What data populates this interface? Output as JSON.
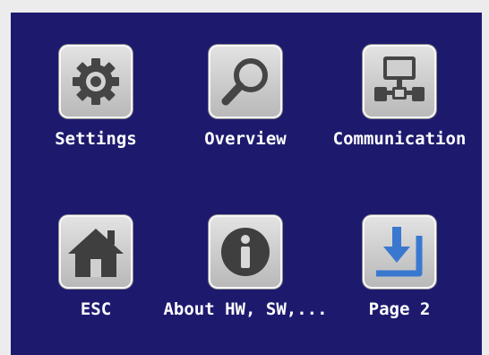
{
  "menu": {
    "items": [
      {
        "label": "Settings",
        "icon": "gear-icon"
      },
      {
        "label": "Overview",
        "icon": "magnifier-icon"
      },
      {
        "label": "Communication",
        "icon": "network-icon"
      },
      {
        "label": "ESC",
        "icon": "home-icon"
      },
      {
        "label": "About HW, SW,...",
        "icon": "info-icon"
      },
      {
        "label": "Page 2",
        "icon": "page-down-icon"
      }
    ]
  },
  "colors": {
    "background": "#1d1a6e",
    "button": "#cfcfcf",
    "icon_dark": "#444444",
    "accent_blue": "#3a78d0"
  }
}
